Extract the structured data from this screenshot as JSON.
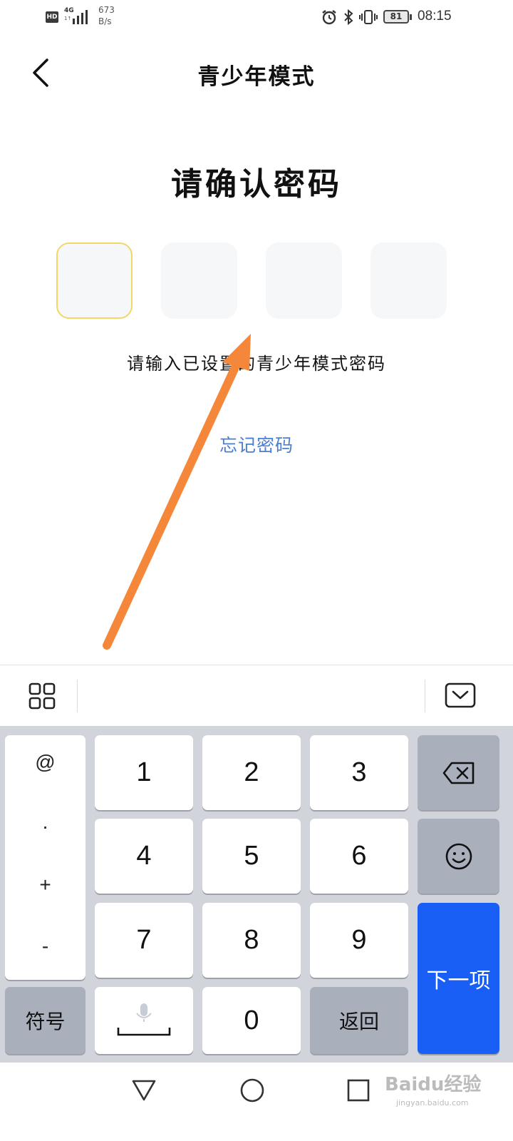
{
  "status_bar": {
    "hd_badge": "HD",
    "network": "4G",
    "network_sub": "1↑",
    "speed_value": "673",
    "speed_unit": "B/s",
    "battery": "81",
    "time": "08:15"
  },
  "header": {
    "title": "青少年模式"
  },
  "main": {
    "heading": "请确认密码",
    "pin_boxes": [
      "",
      "",
      "",
      ""
    ],
    "hint": "请输入已设置的青少年模式密码",
    "forgot_link": "忘记密码"
  },
  "keyboard": {
    "symbols": [
      "@",
      ".",
      "+",
      "-"
    ],
    "digits": [
      "1",
      "2",
      "3",
      "4",
      "5",
      "6",
      "7",
      "8",
      "9",
      "0"
    ],
    "symbols_key": "符号",
    "return_key": "返回",
    "next_key": "下一项"
  },
  "watermark": {
    "brand": "Baidu经验",
    "site": "jingyan.baidu.com"
  },
  "colors": {
    "active_box_border": "#f1d766",
    "link": "#4a7fd1",
    "next_key_bg": "#1a5ff5",
    "arrow": "#f5873a"
  }
}
